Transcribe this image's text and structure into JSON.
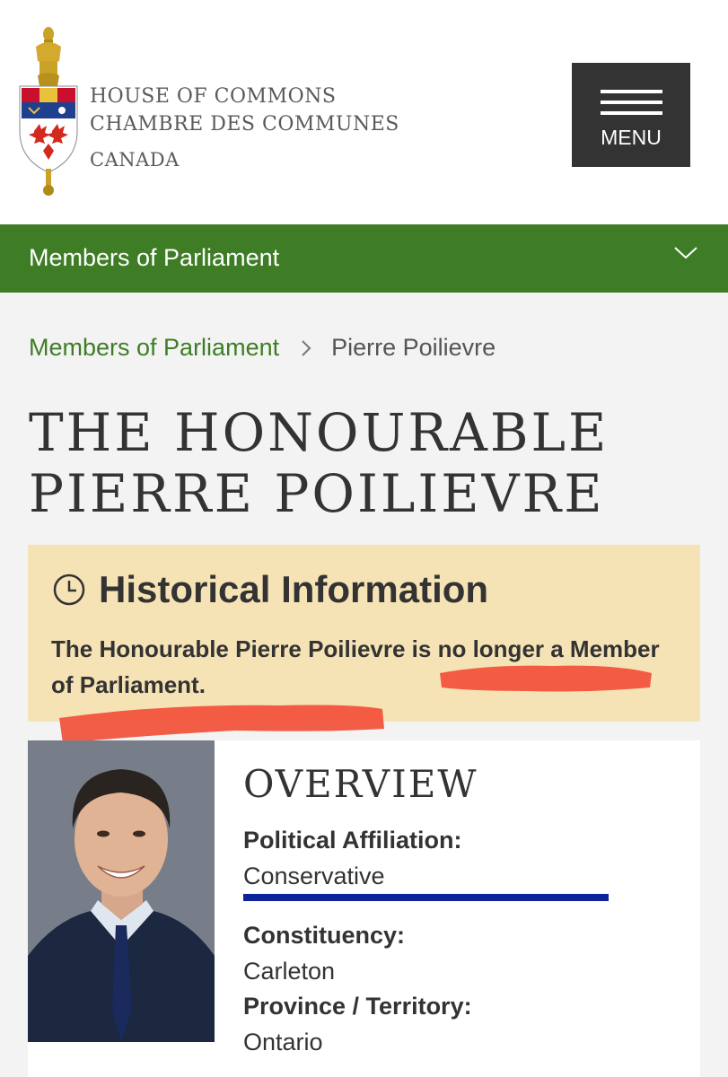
{
  "header": {
    "logo_line1": "HOUSE OF COMMONS",
    "logo_line2": "CHAMBRE DES COMMUNES",
    "logo_line3": "CANADA",
    "menu_label": "MENU"
  },
  "section_bar": {
    "title": "Members of Parliament"
  },
  "breadcrumb": {
    "parent": "Members of Parliament",
    "current": "Pierre Poilievre"
  },
  "page_title": {
    "line1": "THE HONOURABLE",
    "line2": "PIERRE POILIEVRE"
  },
  "historical": {
    "title": "Historical Information",
    "message": "The Honourable Pierre Poilievre is no longer a Member of Parliament."
  },
  "overview": {
    "title": "OVERVIEW",
    "affiliation_label": "Political Affiliation:",
    "affiliation_value": "Conservative",
    "constituency_label": "Constituency:",
    "constituency_value": "Carleton",
    "province_label": "Province / Territory:",
    "province_value": "Ontario"
  },
  "colors": {
    "brand_green": "#3e7d25",
    "notice_bg": "#f6e3b5",
    "party_blue": "#0c2399",
    "annotation_red": "#f2503a",
    "menu_bg": "#333333"
  },
  "icons": [
    "crest-logo",
    "hamburger-icon",
    "chevron-down-icon",
    "chevron-right-icon",
    "clock-icon"
  ]
}
